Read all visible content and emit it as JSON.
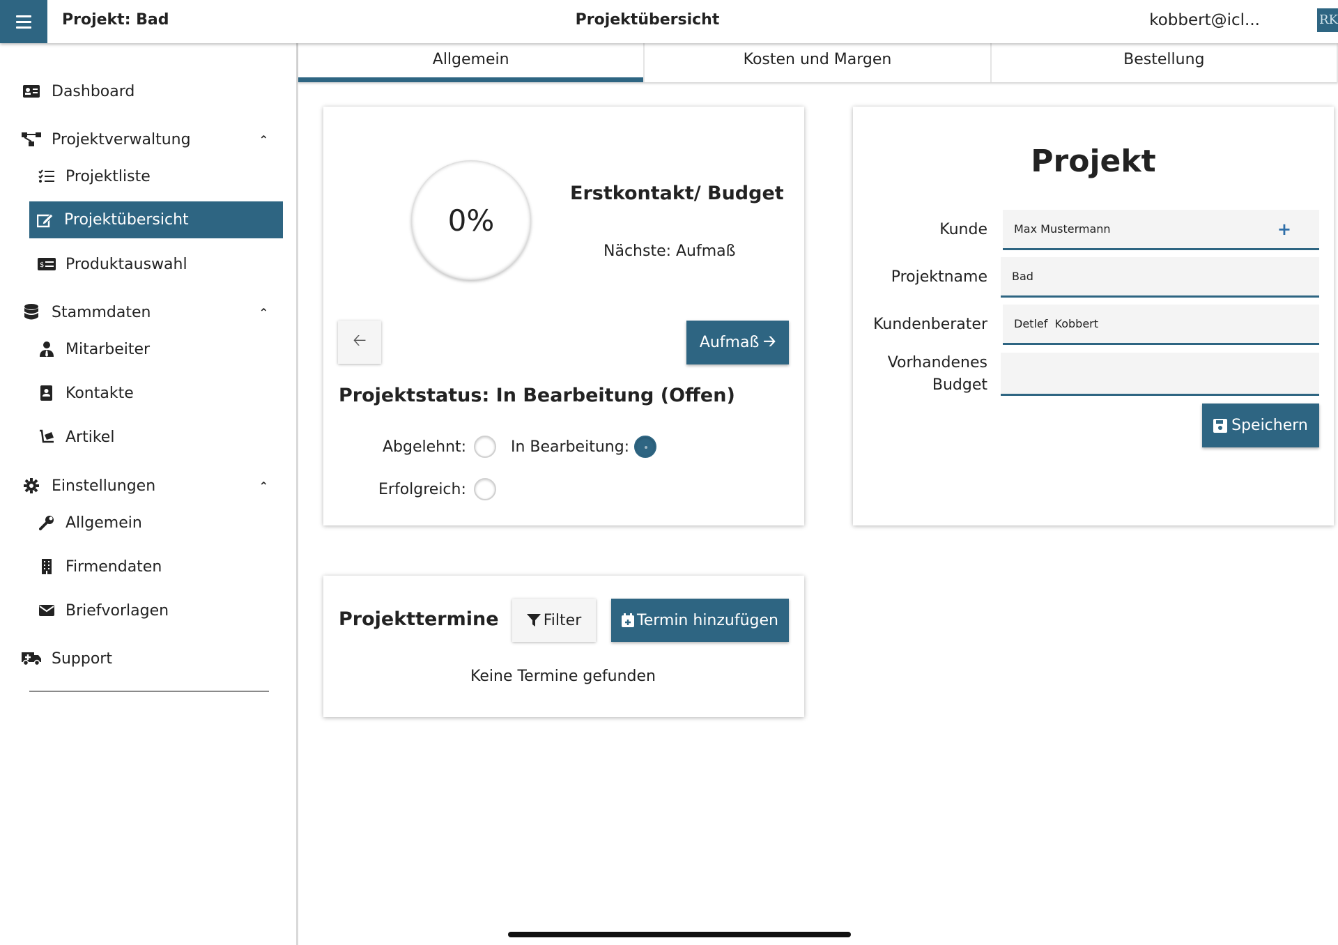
{
  "header": {
    "project_title": "Projekt: Bad",
    "page_title": "Projektübersicht",
    "user_email": "kobbert@icl...",
    "logo_text": "RK",
    "menu_icon": "hamburger-icon"
  },
  "sidebar": {
    "dashboard": "Dashboard",
    "projektverwaltung": "Projektverwaltung",
    "projektliste": "Projektliste",
    "projektuebersicht": "Projektübersicht",
    "produktauswahl": "Produktauswahl",
    "stammdaten": "Stammdaten",
    "mitarbeiter": "Mitarbeiter",
    "kontakte": "Kontakte",
    "artikel": "Artikel",
    "einstellungen": "Einstellungen",
    "allgemein": "Allgemein",
    "firmendaten": "Firmendaten",
    "briefvorlagen": "Briefvorlagen",
    "support": "Support"
  },
  "tabs": {
    "allgemein": "Allgemein",
    "kosten": "Kosten und Margen",
    "bestellung": "Bestellung",
    "selected": "Allgemein"
  },
  "progress": {
    "percent_label": "0%",
    "percent": 0,
    "stage": "Erstkontakt/ Budget",
    "next": "Nächste: Aufmaß",
    "next_button": "Aufmaß"
  },
  "status": {
    "title": "Projektstatus: In Bearbeitung (Offen)",
    "abgelehnt": "Abgelehnt:",
    "in_bearbeitung": "In Bearbeitung:",
    "erfolgreich": "Erfolgreich:",
    "selected": "In Bearbeitung"
  },
  "form": {
    "title": "Projekt",
    "kunde_label": "Kunde",
    "kunde_value": "Max Mustermann",
    "projektname_label": "Projektname",
    "projektname_value": "Bad",
    "kundenberater_label": "Kundenberater",
    "kundenberater_value": "Detlef  Kobbert",
    "budget_label_line1": "Vorhandenes",
    "budget_label_line2": "Budget",
    "budget_value": "",
    "save_button": "Speichern"
  },
  "termine": {
    "title": "Projekttermine",
    "filter_button": "Filter",
    "add_button": "Termin hinzufügen",
    "empty": "Keine Termine gefunden"
  },
  "colors": {
    "accent": "#2e6582",
    "plus": "#2e6ea8"
  }
}
